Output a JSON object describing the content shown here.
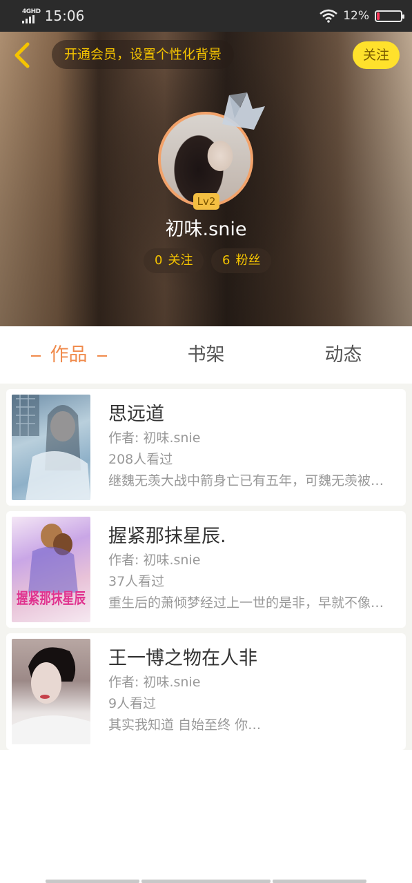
{
  "status_bar": {
    "network": "4GHD",
    "time": "15:06",
    "battery_percent": "12%",
    "battery_level": 0.12,
    "battery_color": "#ff3b5c",
    "icons": [
      "signal-icon",
      "wifi-icon",
      "battery-icon"
    ]
  },
  "header": {
    "back_icon": "chevron-left-icon",
    "vip_promo": "开通会员，设置个性化背景",
    "follow_button": "关注",
    "avatar_crown_icon": "crown-icon",
    "level_badge": "Lv2",
    "username": "初味.snie",
    "following_count": "0",
    "following_label": "关注",
    "fans_count": "6",
    "fans_label": "粉丝"
  },
  "tabs": [
    {
      "label": "作品",
      "active": true
    },
    {
      "label": "书架",
      "active": false
    },
    {
      "label": "动态",
      "active": false
    }
  ],
  "works": [
    {
      "title": "思远道",
      "author": "作者: 初味.snie",
      "views": "208人看过",
      "summary": "继魏无羡大战中箭身亡已有五年，可魏无羡被…"
    },
    {
      "title": "握紧那抹星辰.",
      "author": "作者: 初味.snie",
      "views": "37人看过",
      "summary": "重生后的萧倾梦经过上一世的是非，早就不像…",
      "cover_text": "握紧那抹星辰"
    },
    {
      "title": "王一博之物在人非",
      "author": "作者: 初味.snie",
      "views": "9人看过",
      "summary": "其实我知道 自始至终 你…"
    }
  ],
  "colors": {
    "accent": "#f08a4b",
    "gold": "#f5c400",
    "follow_bg": "#ffe12c"
  }
}
